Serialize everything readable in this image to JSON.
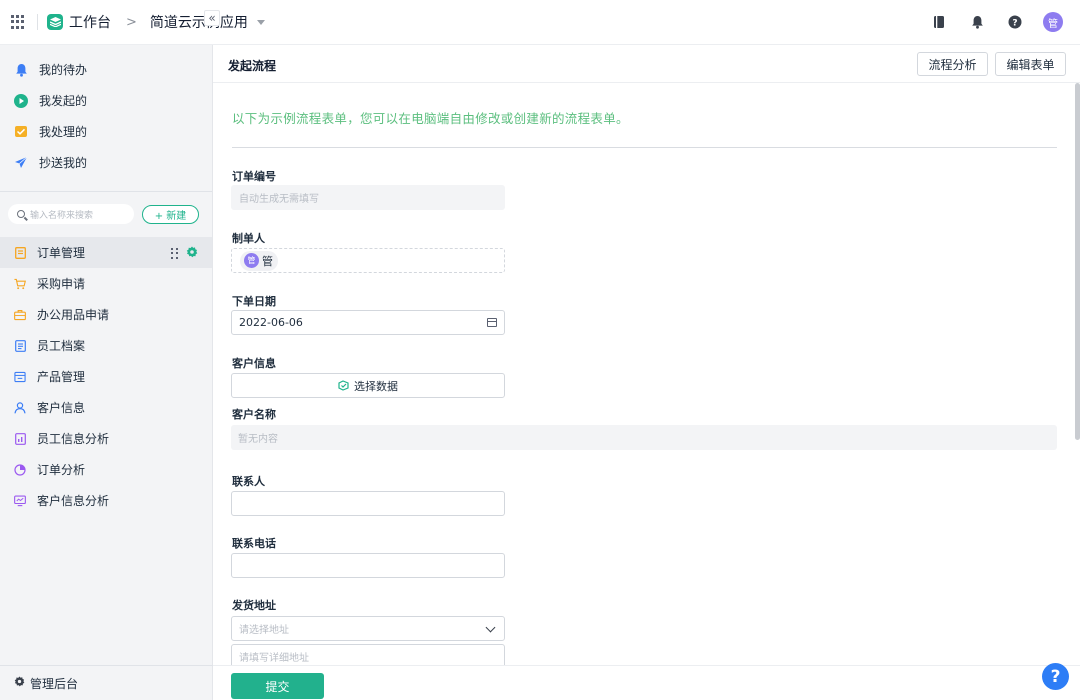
{
  "topbar": {
    "workbench_label": "工作台",
    "breadcrumb_separator": ">",
    "app_name": "简道云示例应用",
    "avatar_text": "管"
  },
  "sidebar": {
    "quick_items": [
      {
        "label": "我的待办",
        "icon": "bell-icon",
        "color": "#3d7ef5"
      },
      {
        "label": "我发起的",
        "icon": "play-circle-icon",
        "color": "#1fb38c"
      },
      {
        "label": "我处理的",
        "icon": "inbox-icon",
        "color": "#f5b026"
      },
      {
        "label": "抄送我的",
        "icon": "send-icon",
        "color": "#3d7ef5"
      }
    ],
    "search_placeholder": "输入名称来搜索",
    "new_button_label": "+ 新建",
    "forms": [
      {
        "label": "订单管理",
        "icon": "form-icon",
        "color": "#f5a623",
        "active": true
      },
      {
        "label": "采购申请",
        "icon": "cart-icon",
        "color": "#f5a623"
      },
      {
        "label": "办公用品申请",
        "icon": "briefcase-icon",
        "color": "#f5a623"
      },
      {
        "label": "员工档案",
        "icon": "document-icon",
        "color": "#3d7ef5"
      },
      {
        "label": "产品管理",
        "icon": "store-icon",
        "color": "#3d7ef5"
      },
      {
        "label": "客户信息",
        "icon": "person-icon",
        "color": "#3d7ef5"
      },
      {
        "label": "员工信息分析",
        "icon": "report-icon",
        "color": "#9b59f0"
      },
      {
        "label": "订单分析",
        "icon": "pie-chart-icon",
        "color": "#9b59f0"
      },
      {
        "label": "客户信息分析",
        "icon": "monitor-chart-icon",
        "color": "#9b59f0"
      }
    ],
    "admin_label": "管理后台"
  },
  "content": {
    "title": "发起流程",
    "buttons": {
      "flow_analysis": "流程分析",
      "edit_form": "编辑表单"
    },
    "notice": "以下为示例流程表单，您可以在电脑端自由修改或创建新的流程表单。",
    "fields": {
      "order_no": {
        "label": "订单编号",
        "placeholder": "自动生成无需填写"
      },
      "creator": {
        "label": "制单人",
        "member_avatar": "管",
        "member_name": "管"
      },
      "order_date": {
        "label": "下单日期",
        "value": "2022-06-06"
      },
      "customer_info": {
        "label": "客户信息",
        "select_button": "选择数据"
      },
      "customer_name": {
        "label": "客户名称",
        "placeholder": "暂无内容"
      },
      "contact": {
        "label": "联系人",
        "value": ""
      },
      "phone": {
        "label": "联系电话",
        "value": ""
      },
      "address": {
        "label": "发货地址",
        "select_placeholder": "请选择地址",
        "detail_placeholder": "请填写详细地址"
      }
    },
    "submit_label": "提交"
  },
  "help_button_label": "?"
}
